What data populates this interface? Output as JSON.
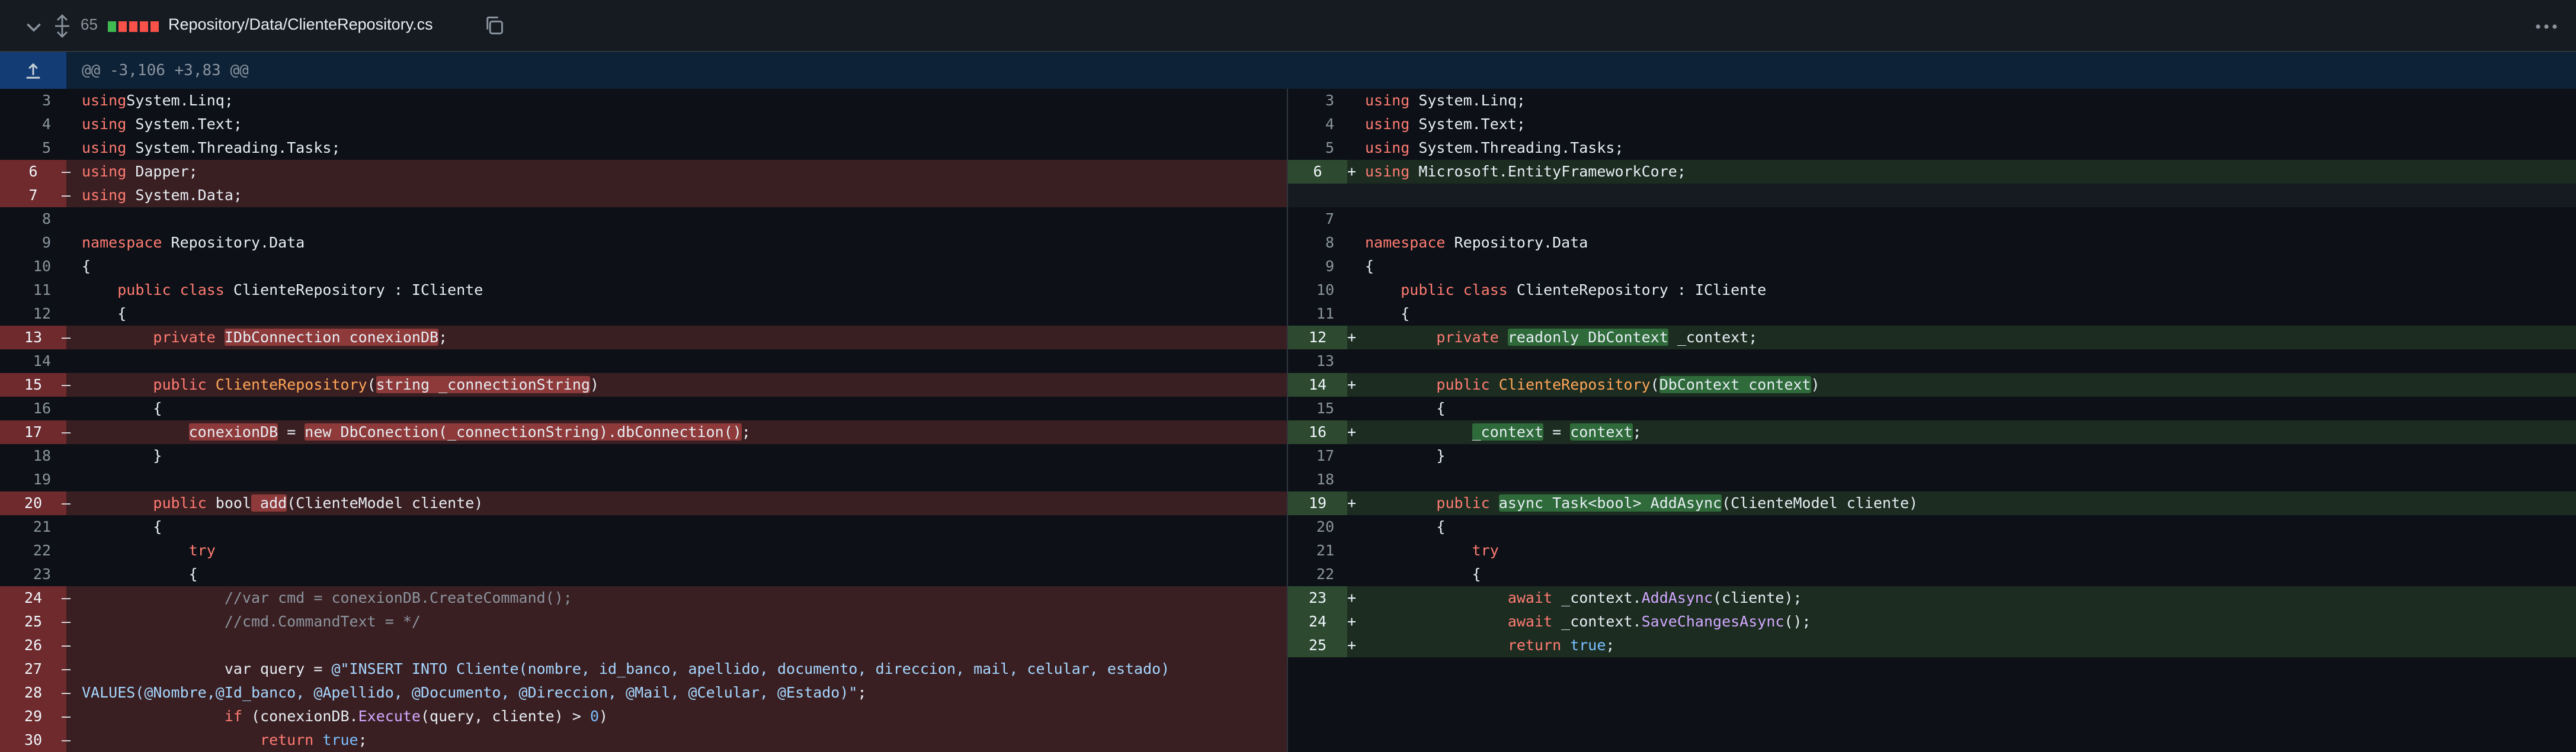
{
  "header": {
    "changes_count": "65",
    "file_path": "Repository/Data/ClienteRepository.cs",
    "diff_blocks": [
      "#3fb950",
      "#f85149",
      "#f85149",
      "#f85149",
      "#f85149"
    ]
  },
  "hunk": {
    "header_text": "@@ -3,106 +3,83 @@"
  },
  "left": [
    {
      "ln": "3",
      "mk": "",
      "type": "ctx",
      "segs": [
        [
          "kw",
          "using"
        ],
        [
          "",
          "System.Linq;"
        ]
      ]
    },
    {
      "ln": "4",
      "mk": "",
      "type": "ctx",
      "segs": [
        [
          "kw",
          "using"
        ],
        [
          "",
          " System.Text;"
        ]
      ]
    },
    {
      "ln": "5",
      "mk": "",
      "type": "ctx",
      "segs": [
        [
          "kw",
          "using"
        ],
        [
          "",
          " System.Threading.Tasks;"
        ]
      ]
    },
    {
      "ln": "6",
      "mk": "–",
      "type": "del",
      "segs": [
        [
          "kw",
          "using"
        ],
        [
          "",
          " Dapper;"
        ]
      ]
    },
    {
      "ln": "7",
      "mk": "–",
      "type": "del",
      "segs": [
        [
          "kw",
          "using"
        ],
        [
          "",
          " System.Data;"
        ]
      ]
    },
    {
      "ln": "8",
      "mk": "",
      "type": "ctx",
      "segs": []
    },
    {
      "ln": "9",
      "mk": "",
      "type": "ctx",
      "segs": [
        [
          "kw",
          "namespace"
        ],
        [
          "",
          " Repository.Data"
        ]
      ]
    },
    {
      "ln": "10",
      "mk": "",
      "type": "ctx",
      "segs": [
        [
          "",
          "{"
        ]
      ]
    },
    {
      "ln": "11",
      "mk": "",
      "type": "ctx",
      "segs": [
        [
          "",
          "    "
        ],
        [
          "kw",
          "public"
        ],
        [
          "",
          " "
        ],
        [
          "kw",
          "class"
        ],
        [
          "",
          " ClienteRepository : ICliente"
        ]
      ]
    },
    {
      "ln": "12",
      "mk": "",
      "type": "ctx",
      "segs": [
        [
          "",
          "    {"
        ]
      ]
    },
    {
      "ln": "13",
      "mk": "–",
      "type": "del",
      "segs": [
        [
          "",
          "        "
        ],
        [
          "kw",
          "private"
        ],
        [
          "",
          " "
        ],
        [
          "hl-del",
          "IDbConnection conexionDB"
        ],
        [
          "",
          ";"
        ]
      ]
    },
    {
      "ln": "14",
      "mk": "",
      "type": "ctx",
      "segs": []
    },
    {
      "ln": "15",
      "mk": "–",
      "type": "del",
      "segs": [
        [
          "",
          "        "
        ],
        [
          "kw",
          "public"
        ],
        [
          "",
          " "
        ],
        [
          "cl",
          "ClienteRepository"
        ],
        [
          "",
          "("
        ],
        [
          "hl-del",
          "string _connectionString"
        ],
        [
          "",
          ")"
        ]
      ]
    },
    {
      "ln": "16",
      "mk": "",
      "type": "ctx",
      "segs": [
        [
          "",
          "        {"
        ]
      ]
    },
    {
      "ln": "17",
      "mk": "–",
      "type": "del",
      "segs": [
        [
          "",
          "            "
        ],
        [
          "hl-del",
          "conexionDB"
        ],
        [
          "",
          " = "
        ],
        [
          "hl-del",
          "new DbConection(_connectionString).dbConnection()"
        ],
        [
          "",
          ";"
        ]
      ]
    },
    {
      "ln": "18",
      "mk": "",
      "type": "ctx",
      "segs": [
        [
          "",
          "        }"
        ]
      ]
    },
    {
      "ln": "19",
      "mk": "",
      "type": "ctx",
      "segs": []
    },
    {
      "ln": "20",
      "mk": "–",
      "type": "del",
      "segs": [
        [
          "",
          "        "
        ],
        [
          "kw",
          "public"
        ],
        [
          "",
          " bool"
        ],
        [
          "hl-del",
          " add"
        ],
        [
          "",
          "(ClienteModel cliente)"
        ]
      ]
    },
    {
      "ln": "21",
      "mk": "",
      "type": "ctx",
      "segs": [
        [
          "",
          "        {"
        ]
      ]
    },
    {
      "ln": "22",
      "mk": "",
      "type": "ctx",
      "segs": [
        [
          "",
          "            "
        ],
        [
          "kw",
          "try"
        ]
      ]
    },
    {
      "ln": "23",
      "mk": "",
      "type": "ctx",
      "segs": [
        [
          "",
          "            {"
        ]
      ]
    },
    {
      "ln": "24",
      "mk": "–",
      "type": "del",
      "segs": [
        [
          "",
          "                "
        ],
        [
          "cm",
          "//var cmd = conexionDB.CreateCommand();"
        ]
      ]
    },
    {
      "ln": "25",
      "mk": "–",
      "type": "del",
      "segs": [
        [
          "",
          "                "
        ],
        [
          "cm",
          "//cmd.CommandText = */"
        ]
      ]
    },
    {
      "ln": "26",
      "mk": "–",
      "type": "del",
      "segs": []
    },
    {
      "ln": "27",
      "mk": "–",
      "type": "del",
      "segs": [
        [
          "",
          "                var query = "
        ],
        [
          "st",
          "@\"INSERT INTO Cliente(nombre, id_banco, apellido, documento, direccion, mail, celular, estado)"
        ]
      ]
    },
    {
      "ln": "28",
      "mk": "–",
      "type": "del",
      "segs": [
        [
          "st",
          "VALUES(@Nombre,@Id_banco, @Apellido, @Documento, @Direccion, @Mail, @Celular, @Estado)\""
        ],
        [
          "",
          ";"
        ]
      ]
    },
    {
      "ln": "29",
      "mk": "–",
      "type": "del",
      "segs": [
        [
          "",
          "                "
        ],
        [
          "kw",
          "if"
        ],
        [
          "",
          " (conexionDB."
        ],
        [
          "fn",
          "Execute"
        ],
        [
          "",
          "(query, cliente) > "
        ],
        [
          "num",
          "0"
        ],
        [
          "",
          ")"
        ]
      ]
    },
    {
      "ln": "30",
      "mk": "–",
      "type": "del",
      "segs": [
        [
          "",
          "                    "
        ],
        [
          "kw",
          "return"
        ],
        [
          "",
          " "
        ],
        [
          "num",
          "true"
        ],
        [
          "",
          ";"
        ]
      ]
    }
  ],
  "right": [
    {
      "ln": "3",
      "mk": "",
      "type": "ctx",
      "segs": [
        [
          "kw",
          "using"
        ],
        [
          "",
          " System.Linq;"
        ]
      ]
    },
    {
      "ln": "4",
      "mk": "",
      "type": "ctx",
      "segs": [
        [
          "kw",
          "using"
        ],
        [
          "",
          " System.Text;"
        ]
      ]
    },
    {
      "ln": "5",
      "mk": "",
      "type": "ctx",
      "segs": [
        [
          "kw",
          "using"
        ],
        [
          "",
          " System.Threading.Tasks;"
        ]
      ]
    },
    {
      "ln": "6",
      "mk": "+",
      "type": "add",
      "segs": [
        [
          "kw",
          "using"
        ],
        [
          "",
          " Microsoft.EntityFrameworkCore;"
        ]
      ]
    },
    {
      "ln": "",
      "mk": "",
      "type": "empty",
      "segs": []
    },
    {
      "ln": "7",
      "mk": "",
      "type": "ctx",
      "segs": []
    },
    {
      "ln": "8",
      "mk": "",
      "type": "ctx",
      "segs": [
        [
          "kw",
          "namespace"
        ],
        [
          "",
          " Repository.Data"
        ]
      ]
    },
    {
      "ln": "9",
      "mk": "",
      "type": "ctx",
      "segs": [
        [
          "",
          "{"
        ]
      ]
    },
    {
      "ln": "10",
      "mk": "",
      "type": "ctx",
      "segs": [
        [
          "",
          "    "
        ],
        [
          "kw",
          "public"
        ],
        [
          "",
          " "
        ],
        [
          "kw",
          "class"
        ],
        [
          "",
          " ClienteRepository : ICliente"
        ]
      ]
    },
    {
      "ln": "11",
      "mk": "",
      "type": "ctx",
      "segs": [
        [
          "",
          "    {"
        ]
      ]
    },
    {
      "ln": "12",
      "mk": "+",
      "type": "add",
      "segs": [
        [
          "",
          "        "
        ],
        [
          "kw",
          "private"
        ],
        [
          "",
          " "
        ],
        [
          "hl-add",
          "readonly DbContext"
        ],
        [
          "",
          " _context;"
        ]
      ]
    },
    {
      "ln": "13",
      "mk": "",
      "type": "ctx",
      "segs": []
    },
    {
      "ln": "14",
      "mk": "+",
      "type": "add",
      "segs": [
        [
          "",
          "        "
        ],
        [
          "kw",
          "public"
        ],
        [
          "",
          " "
        ],
        [
          "cl",
          "ClienteRepository"
        ],
        [
          "",
          "("
        ],
        [
          "hl-add",
          "DbContext context"
        ],
        [
          "",
          ")"
        ]
      ]
    },
    {
      "ln": "15",
      "mk": "",
      "type": "ctx",
      "segs": [
        [
          "",
          "        {"
        ]
      ]
    },
    {
      "ln": "16",
      "mk": "+",
      "type": "add",
      "segs": [
        [
          "",
          "            "
        ],
        [
          "hl-add",
          "_context"
        ],
        [
          "",
          " = "
        ],
        [
          "hl-add",
          "context"
        ],
        [
          "",
          ";"
        ]
      ]
    },
    {
      "ln": "17",
      "mk": "",
      "type": "ctx",
      "segs": [
        [
          "",
          "        }"
        ]
      ]
    },
    {
      "ln": "18",
      "mk": "",
      "type": "ctx",
      "segs": []
    },
    {
      "ln": "19",
      "mk": "+",
      "type": "add",
      "segs": [
        [
          "",
          "        "
        ],
        [
          "kw",
          "public"
        ],
        [
          "",
          " "
        ],
        [
          "hl-add",
          "async Task<bool> AddAsync"
        ],
        [
          "",
          "(ClienteModel cliente)"
        ]
      ]
    },
    {
      "ln": "20",
      "mk": "",
      "type": "ctx",
      "segs": [
        [
          "",
          "        {"
        ]
      ]
    },
    {
      "ln": "21",
      "mk": "",
      "type": "ctx",
      "segs": [
        [
          "",
          "            "
        ],
        [
          "kw",
          "try"
        ]
      ]
    },
    {
      "ln": "22",
      "mk": "",
      "type": "ctx",
      "segs": [
        [
          "",
          "            {"
        ]
      ]
    },
    {
      "ln": "23",
      "mk": "+",
      "type": "add",
      "segs": [
        [
          "",
          "                "
        ],
        [
          "kw",
          "await"
        ],
        [
          "",
          " _context."
        ],
        [
          "fn",
          "AddAsync"
        ],
        [
          "",
          "(cliente);"
        ]
      ]
    },
    {
      "ln": "24",
      "mk": "+",
      "type": "add",
      "segs": [
        [
          "",
          "                "
        ],
        [
          "kw",
          "await"
        ],
        [
          "",
          " _context."
        ],
        [
          "fn",
          "SaveChangesAsync"
        ],
        [
          "",
          "();"
        ]
      ]
    },
    {
      "ln": "25",
      "mk": "+",
      "type": "add",
      "segs": [
        [
          "",
          "                "
        ],
        [
          "kw",
          "return"
        ],
        [
          "",
          " "
        ],
        [
          "num",
          "true"
        ],
        [
          "",
          ";"
        ]
      ]
    }
  ]
}
